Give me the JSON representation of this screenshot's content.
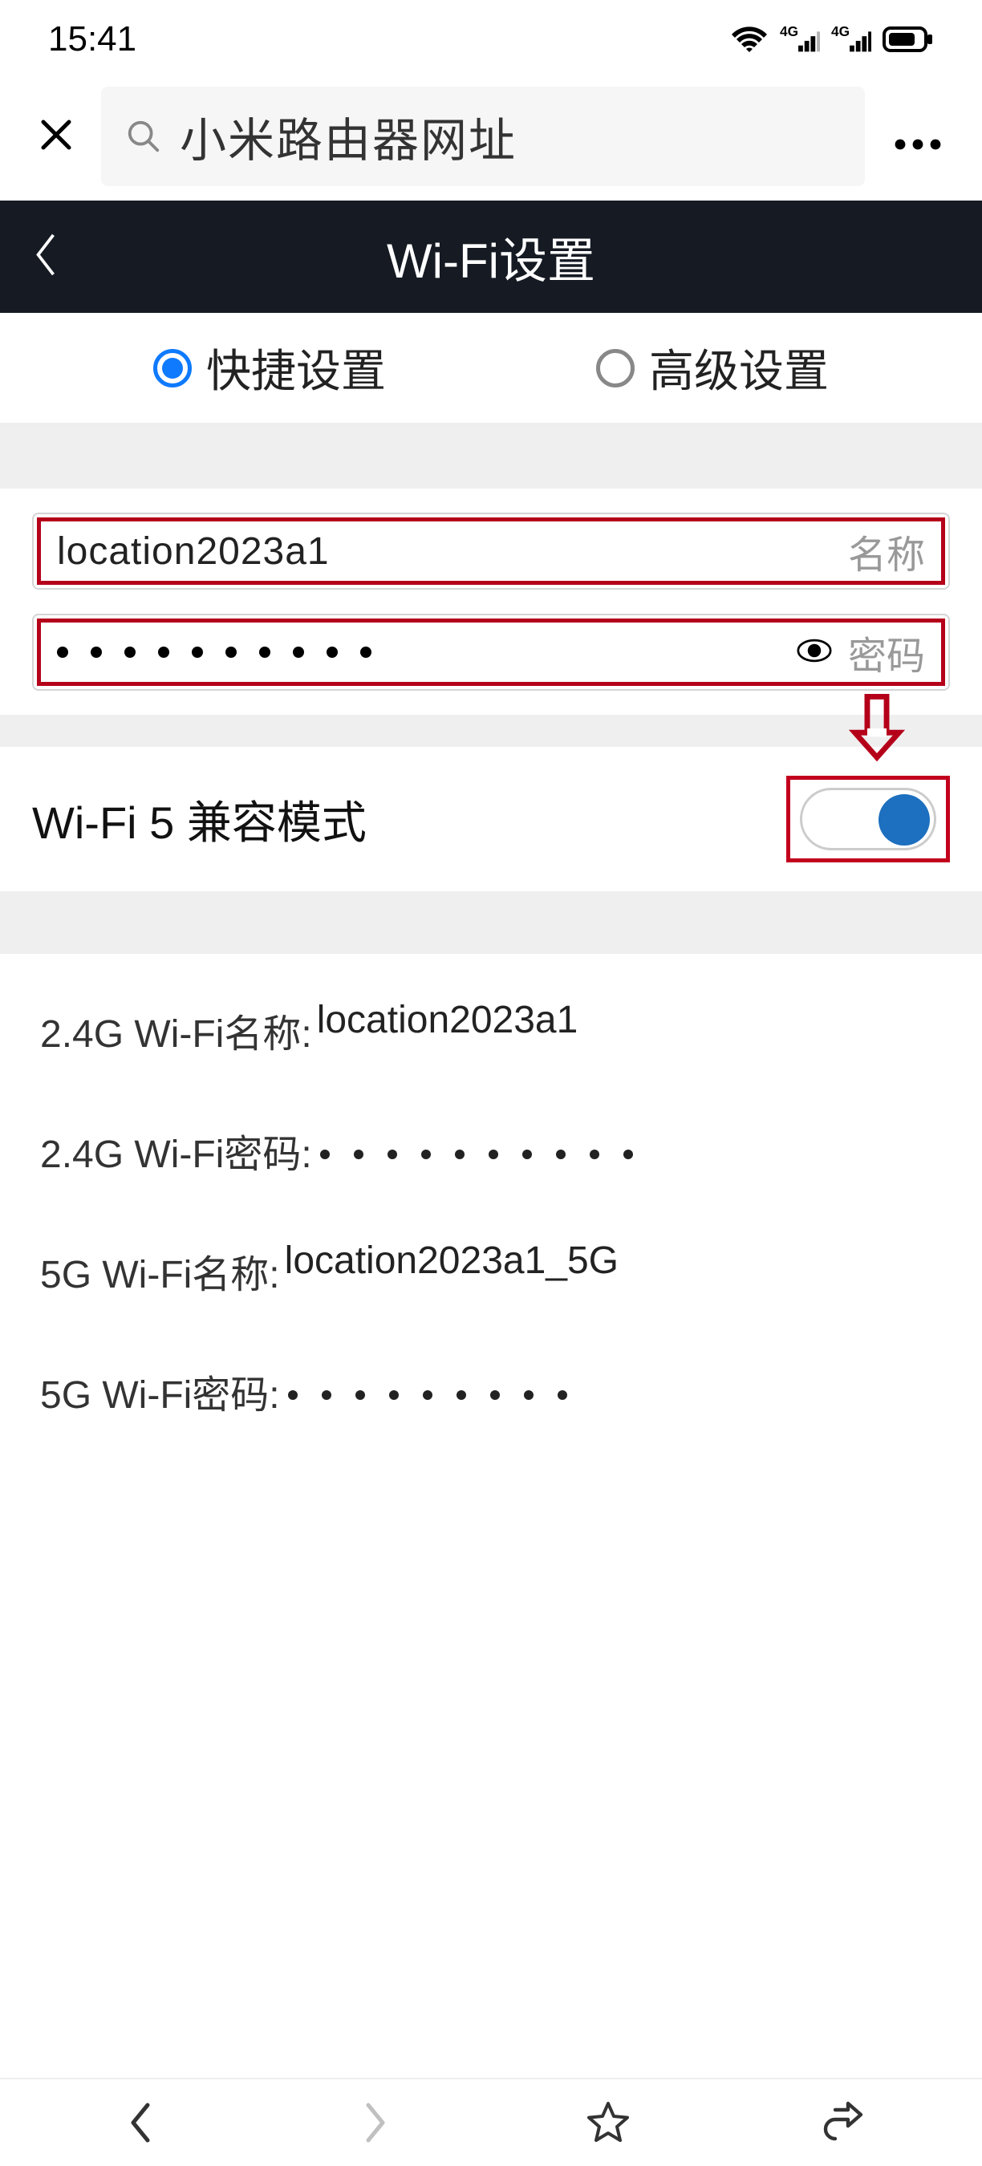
{
  "status": {
    "time": "15:41"
  },
  "browser": {
    "search_text": "小米路由器网址"
  },
  "app": {
    "title": "Wi-Fi设置"
  },
  "tabs": {
    "quick": "快捷设置",
    "advanced": "高级设置"
  },
  "form": {
    "name_value": "location2023a1",
    "name_label": "名称",
    "password_label": "密码"
  },
  "wifi5": {
    "label": "Wi-Fi 5 兼容模式"
  },
  "details": {
    "name24_label": "2.4G Wi-Fi名称:",
    "name24_value": "location2023a1",
    "pass24_label": "2.4G Wi-Fi密码:",
    "name5_label": "5G Wi-Fi名称:",
    "name5_value": "location2023a1_5G",
    "pass5_label": "5G Wi-Fi密码:"
  }
}
